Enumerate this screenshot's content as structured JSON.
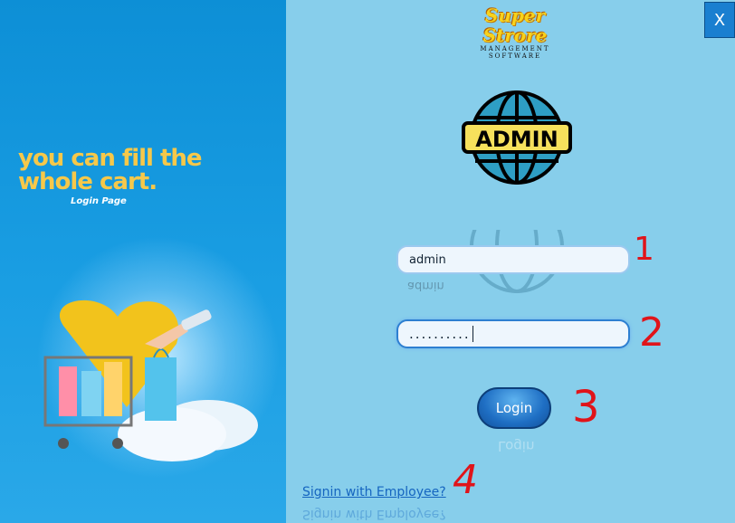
{
  "window": {
    "close_label": "X"
  },
  "promo": {
    "tagline": "you can fill the\nwhole cart.",
    "subtitle": "Login Page"
  },
  "brand": {
    "line1": "Super",
    "line2": "Strore",
    "line3": "MANAGEMENT",
    "line4": "SOFTWARE"
  },
  "admin_badge": {
    "label": "ADMIN"
  },
  "form": {
    "username_value": "admin",
    "password_value": "..........",
    "login_label": "Login",
    "employee_link": "Signin with Employee?"
  },
  "annotations": [
    "1",
    "2",
    "3",
    "4"
  ],
  "colors": {
    "left_panel": "#1a9ee3",
    "right_panel": "#87CEEB",
    "accent": "#f6c84a",
    "button": "#1f6fc4",
    "annotation": "#e0141a"
  }
}
